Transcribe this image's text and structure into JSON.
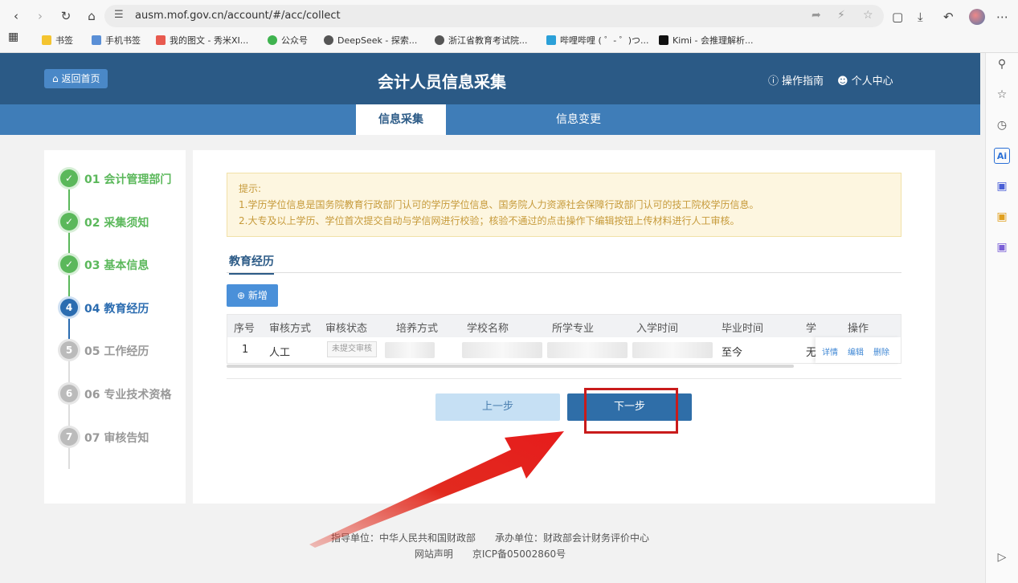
{
  "browser": {
    "url": "ausm.mof.gov.cn/account/#/acc/collect",
    "bookmarks": [
      "书签",
      "手机书签",
      "我的图文 - 秀米XI...",
      "公众号",
      "DeepSeek - 探索...",
      "浙江省教育考试院...",
      "哔哩哔哩 ( ゜- ゜)つ...",
      "Kimi - 会推理解析..."
    ]
  },
  "header": {
    "back_home": "返回首页",
    "title": "会计人员信息采集",
    "guide": "操作指南",
    "personal_center": "个人中心"
  },
  "tabs": [
    {
      "label": "信息采集",
      "active": true
    },
    {
      "label": "信息变更",
      "active": false
    }
  ],
  "steps": [
    {
      "label": "01 会计管理部门",
      "state": "done"
    },
    {
      "label": "02 采集须知",
      "state": "done"
    },
    {
      "label": "03 基本信息",
      "state": "done"
    },
    {
      "label": "04 教育经历",
      "state": "current",
      "num": "4"
    },
    {
      "label": "05 工作经历",
      "state": "todo",
      "num": "5"
    },
    {
      "label": "06 专业技术资格",
      "state": "todo",
      "num": "6"
    },
    {
      "label": "07 审核告知",
      "state": "todo",
      "num": "7"
    }
  ],
  "notice": {
    "title": "提示:",
    "line1": "1.学历学位信息是国务院教育行政部门认可的学历学位信息、国务院人力资源社会保障行政部门认可的技工院校学历信息。",
    "line2": "2.大专及以上学历、学位首次提交自动与学信网进行校验；核验不通过的点击操作下编辑按钮上传材料进行人工审核。"
  },
  "section": {
    "title": "教育经历",
    "add_button": "新增"
  },
  "table": {
    "columns": [
      "序号",
      "审核方式",
      "审核状态",
      "培养方式",
      "学校名称",
      "所学专业",
      "入学时间",
      "毕业时间",
      "学",
      "操作"
    ],
    "rows": [
      {
        "index": "1",
        "review_method": "人工",
        "review_status": "未提交审核",
        "graduation": "至今",
        "degree": "无",
        "actions": [
          "详情",
          "编辑",
          "删除"
        ]
      }
    ]
  },
  "buttons": {
    "prev": "上一步",
    "next": "下一步"
  },
  "footer": {
    "line1": "指导单位：中华人民共和国财政部　　承办单位：财政部会计财务评价中心",
    "line2": "网站声明　　京ICP备05002860号"
  },
  "colors": {
    "header_bg": "#2b5a86",
    "tab_bar": "#3f7db8",
    "done_green": "#5bb85b",
    "current_blue": "#2b6cb0",
    "highlight_red": "#c91b1b"
  }
}
